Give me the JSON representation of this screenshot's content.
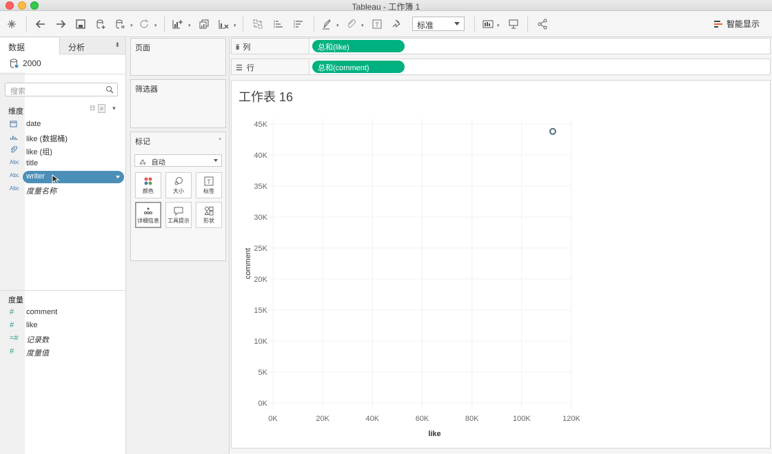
{
  "window": {
    "title": "Tableau - 工作簿 1"
  },
  "toolbar": {
    "standard_select": "标准",
    "smart_show": "智能显示",
    "colors": {
      "accent": "#00b180"
    }
  },
  "left_panel": {
    "tabs": {
      "data": "数据",
      "analysis": "分析"
    },
    "datasource": "2000",
    "search_placeholder": "搜索",
    "dimensions_header": "维度",
    "dimensions": [
      {
        "icon": "calendar-icon",
        "name": "date"
      },
      {
        "icon": "bins-icon",
        "name": "like (数据桶)"
      },
      {
        "icon": "paperclip-icon",
        "name": "like (组)"
      },
      {
        "icon": "abc-icon",
        "name": "title",
        "icon_text": "Abc"
      },
      {
        "icon": "abc-icon",
        "name": "writer",
        "icon_text": "Abc",
        "selected": true
      },
      {
        "icon": "abc-icon",
        "name": "度量名称",
        "icon_text": "Abc",
        "italic": true
      }
    ],
    "measures_header": "度量",
    "measures": [
      {
        "icon": "hash-icon",
        "name": "comment",
        "icon_text": "#"
      },
      {
        "icon": "hash-icon",
        "name": "like",
        "icon_text": "#"
      },
      {
        "icon": "hash-icon",
        "name": "记录数",
        "icon_text": "=#",
        "italic": true
      },
      {
        "icon": "hash-icon",
        "name": "度量值",
        "icon_text": "#",
        "italic": true
      }
    ]
  },
  "mid_panel": {
    "pages_title": "页面",
    "filters_title": "筛选器",
    "marks_title": "标记",
    "marks_type": "自动",
    "mark_buttons": [
      "颜色",
      "大小",
      "标签",
      "详细信息",
      "工具提示",
      "形状"
    ]
  },
  "shelves": {
    "columns_label": "列",
    "columns_pill": "总和(like)",
    "rows_label": "行",
    "rows_pill": "总和(comment)"
  },
  "sheet": {
    "title": "工作表 16"
  },
  "chart_data": {
    "type": "scatter",
    "xlabel": "like",
    "ylabel": "comment",
    "x_ticks": [
      "0K",
      "20K",
      "40K",
      "60K",
      "80K",
      "100K",
      "120K"
    ],
    "y_ticks": [
      "0K",
      "5K",
      "10K",
      "15K",
      "20K",
      "25K",
      "30K",
      "35K",
      "40K",
      "45K"
    ],
    "xlim": [
      0,
      120000
    ],
    "ylim": [
      0,
      45000
    ],
    "points": [
      {
        "x": 112500,
        "y": 43800
      }
    ],
    "grid": true,
    "marker_color": "#4e6e80"
  }
}
